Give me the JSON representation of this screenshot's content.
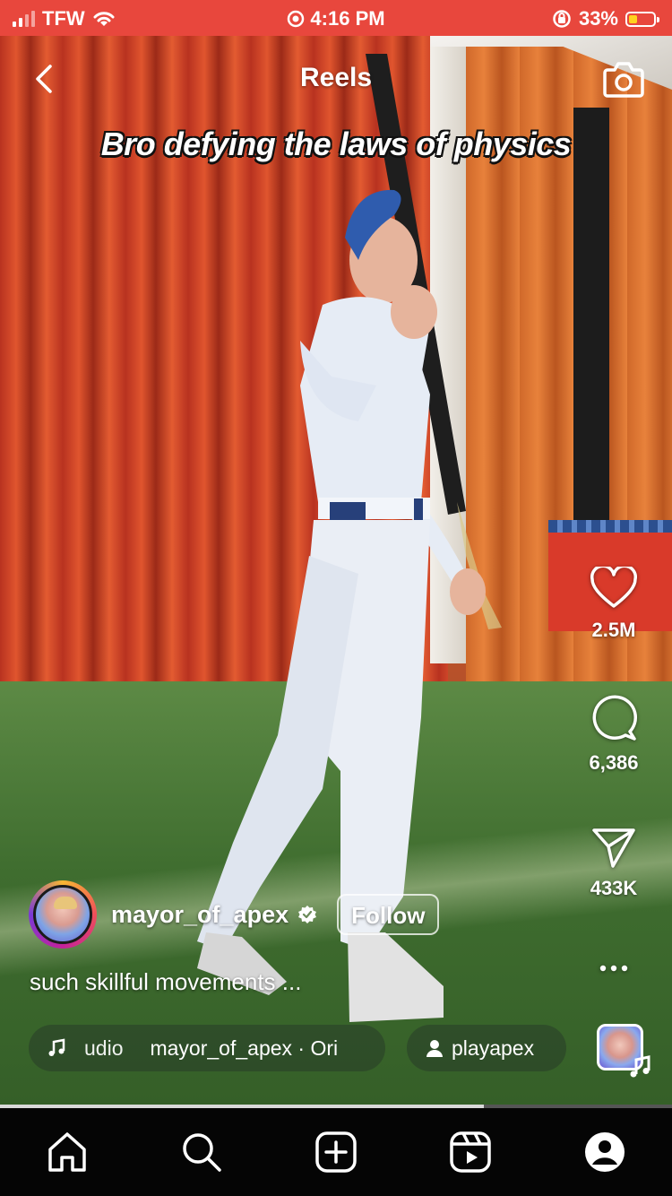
{
  "status": {
    "carrier": "TFW",
    "time": "4:16 PM",
    "battery": "33%",
    "battery_level": 0.33
  },
  "header": {
    "title": "Reels"
  },
  "video": {
    "overlay_caption": "Bro defying the laws of physics",
    "progress": 0.72
  },
  "actions": {
    "likes": "2.5M",
    "comments": "6,386",
    "shares": "433K"
  },
  "author": {
    "username": "mayor_of_apex",
    "verified": true,
    "follow_label": "Follow"
  },
  "caption": "such skillful movements ...",
  "audio": {
    "text_partial": "udio",
    "source": "mayor_of_apex · Ori",
    "tag": "playapex"
  },
  "icons": [
    "back-chevron-icon",
    "camera-icon",
    "heart-icon",
    "comment-icon",
    "share-icon",
    "more-icon",
    "music-note-icon",
    "person-icon",
    "home-icon",
    "search-icon",
    "create-icon",
    "reels-icon",
    "profile-icon"
  ],
  "colors": {
    "status_bar": "#e8473d",
    "battery_fill": "#ffd21f",
    "tab_bar": "#050505"
  }
}
